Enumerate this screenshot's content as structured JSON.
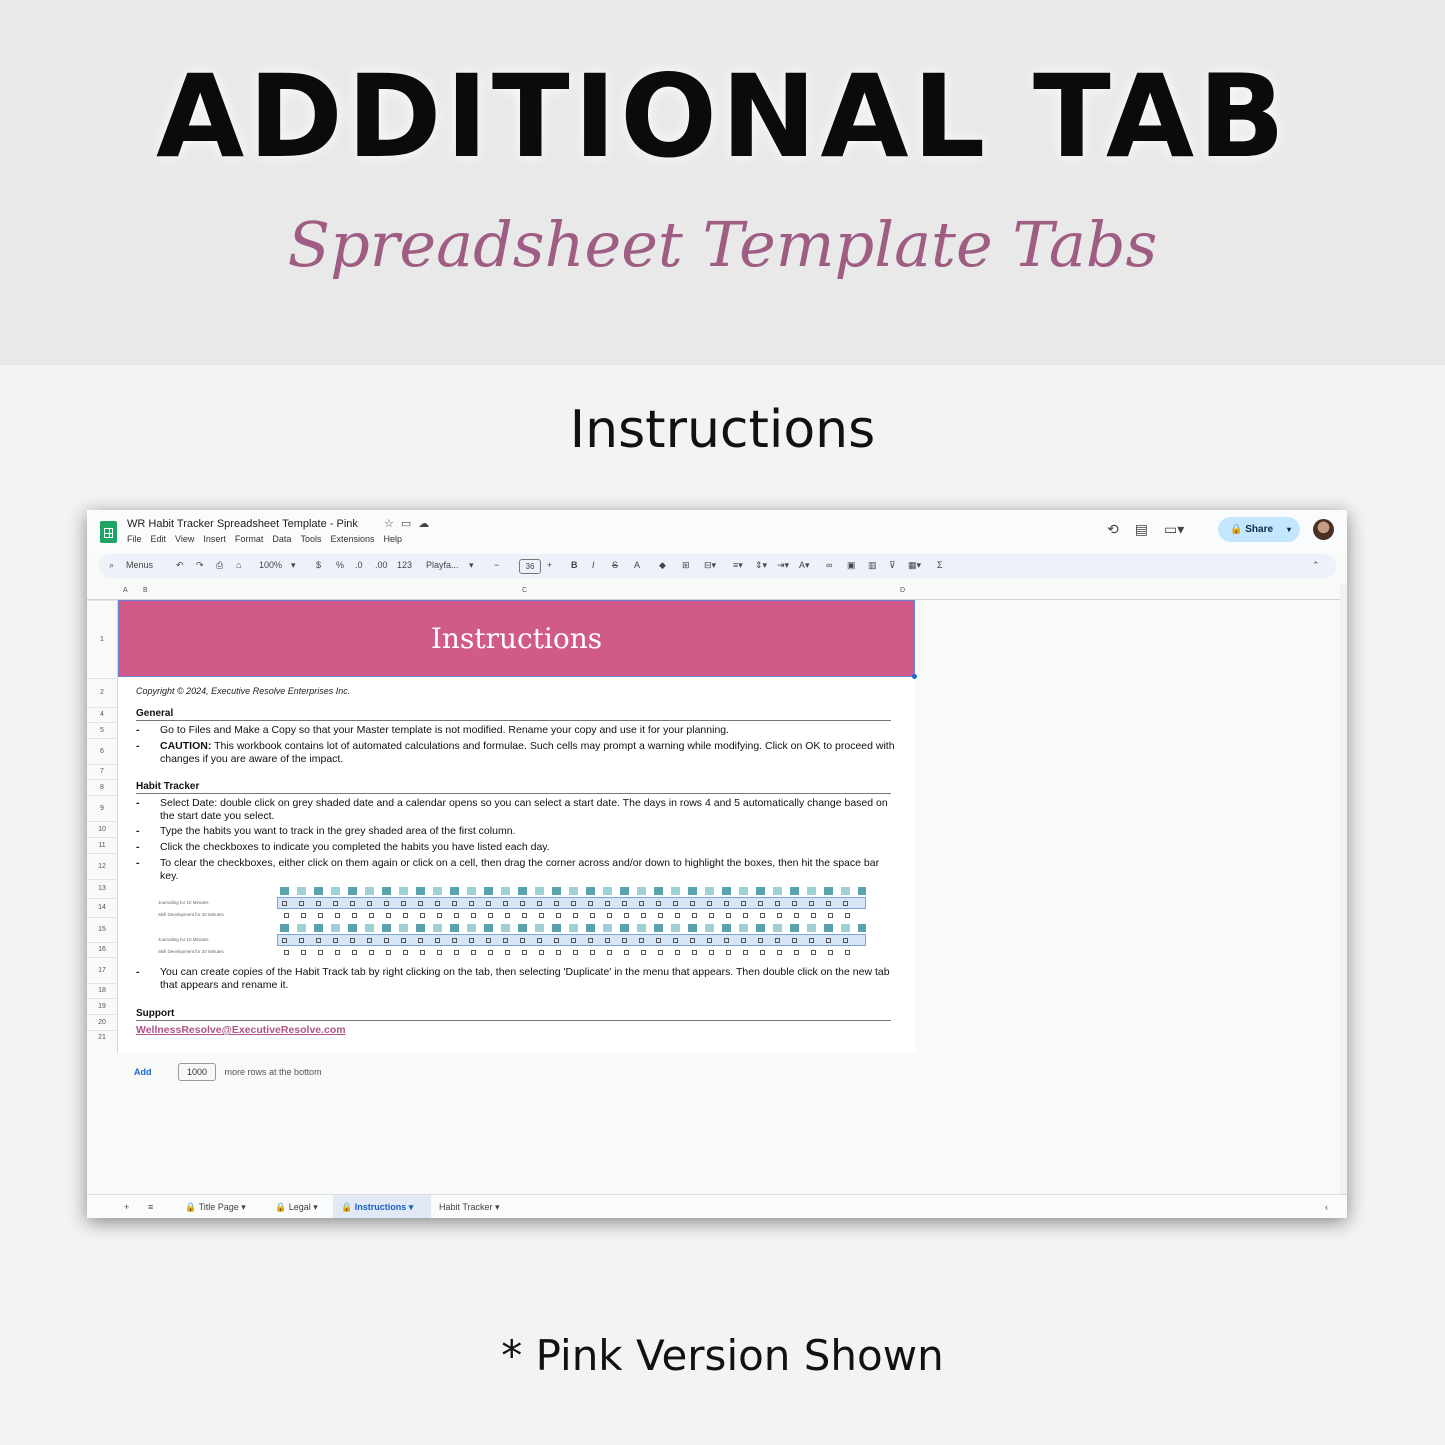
{
  "hero": {
    "title": "ADDITIONAL TAB",
    "subtitle": "Spreadsheet Template Tabs"
  },
  "section_label": "Instructions",
  "footnote": "* Pink Version Shown",
  "app": {
    "doc_title": "WR Habit Tracker Spreadsheet Template - Pink",
    "menu": [
      "File",
      "Edit",
      "View",
      "Insert",
      "Format",
      "Data",
      "Tools",
      "Extensions",
      "Help"
    ],
    "share_label": "Share",
    "toolbar": {
      "search": "Menus",
      "zoom": "100%",
      "currency": "$",
      "percent": "%",
      "dec_less": ".0",
      "dec_more": ".00",
      "format_num": "123",
      "font": "Playfa...",
      "font_size": "36"
    },
    "columns": [
      "A",
      "B",
      "C",
      "D"
    ],
    "rows": [
      "1",
      "2",
      "4",
      "5",
      "6",
      "7",
      "8",
      "9",
      "10",
      "11",
      "12",
      "13",
      "14",
      "15",
      "16",
      "17",
      "18",
      "19",
      "20",
      "21"
    ]
  },
  "sheet": {
    "banner": "Instructions",
    "copyright": "Copyright © 2024, Executive Resolve Enterprises Inc.",
    "general": {
      "heading": "General",
      "bullets": [
        "Go to Files and Make a Copy so that your Master template is not modified. Rename your copy and use it for your planning.",
        "This workbook contains lot of automated calculations and formulae. Such cells may prompt a warning while modifying. Click on OK to proceed with changes if you are aware of the impact."
      ],
      "caution_label": "CAUTION:"
    },
    "habit": {
      "heading": "Habit Tracker",
      "bullets": [
        "Select Date: double click on grey shaded date and a calendar opens so you can select a start date. The days in rows 4 and 5 automatically change based on the start date you select.",
        "Type the habits you want to track in the grey shaded area of the first column.",
        "Click the checkboxes to indicate you completed the habits you have listed each day.",
        "To clear the checkboxes, either click on them again or click on a cell, then drag the corner across and/or down to highlight the boxes, then hit the space bar key.",
        "You can create copies of the Habit Track tab by right clicking on the tab, then selecting 'Duplicate' in the menu that appears. Then double click on the new tab that appears and rename it."
      ],
      "preview_labels": [
        "Journaling for 10 Minutes",
        "Skill Development for 20 Minutes"
      ]
    },
    "support": {
      "heading": "Support",
      "email": "WellnessResolve@ExecutiveResolve.com"
    },
    "add_rows": {
      "add": "Add",
      "count": "1000",
      "suffix": "more rows at the bottom"
    }
  },
  "tabs": [
    "Title Page",
    "Legal",
    "Instructions",
    "Habit Tracker"
  ],
  "colors": {
    "banner": "#d05a88",
    "subtitle": "#9f5d83",
    "link": "#b05486",
    "share": "#c2e7ff"
  }
}
